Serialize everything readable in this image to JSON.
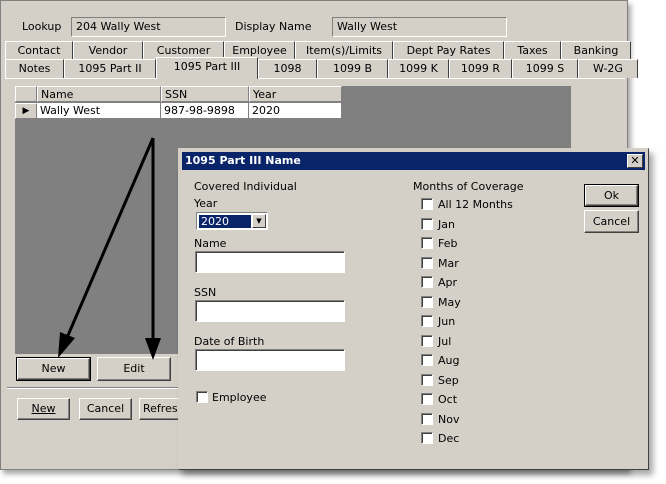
{
  "header": {
    "lookup_label": "Lookup",
    "lookup_value": "204 Wally West",
    "display_name_label": "Display Name",
    "display_name_value": "Wally West"
  },
  "tabs_row1": [
    "Contact",
    "Vendor",
    "Customer",
    "Employee",
    "Item(s)/Limits",
    "Dept Pay Rates",
    "Taxes",
    "Banking"
  ],
  "tabs_row2": [
    "Notes",
    "1095 Part II",
    "1095 Part III",
    "1098",
    "1099 B",
    "1099 K",
    "1099 R",
    "1099 S",
    "W-2G"
  ],
  "active_tab": "1095 Part III",
  "grid": {
    "columns": [
      "Name",
      "SSN",
      "Year"
    ],
    "rows": [
      {
        "name": "Wally West",
        "ssn": "987-98-9898",
        "year": "2020"
      }
    ]
  },
  "grid_buttons": {
    "new_label": "New",
    "edit_label": "Edit"
  },
  "bottom_buttons": {
    "new_label": "New",
    "cancel_label": "Cancel",
    "refresh_label": "Refresh"
  },
  "dialog": {
    "title": "1095 Part III Name",
    "close_glyph": "✕",
    "covered_individual_label": "Covered Individual",
    "year_label": "Year",
    "year_value": "2020",
    "name_label": "Name",
    "name_value": "",
    "ssn_label": "SSN",
    "ssn_value": "",
    "dob_label": "Date of Birth",
    "dob_value": "",
    "employee_label": "Employee",
    "months_label": "Months of Coverage",
    "months": [
      "All 12 Months",
      "Jan",
      "Feb",
      "Mar",
      "Apr",
      "May",
      "Jun",
      "Jul",
      "Aug",
      "Sep",
      "Oct",
      "Nov",
      "Dec"
    ],
    "ok_label": "Ok",
    "cancel_label": "Cancel"
  },
  "colors": {
    "window_bg": "#d4d0c8",
    "title_bar": "#0a246a",
    "grid_bg": "#808080",
    "arrow": "#000000"
  }
}
